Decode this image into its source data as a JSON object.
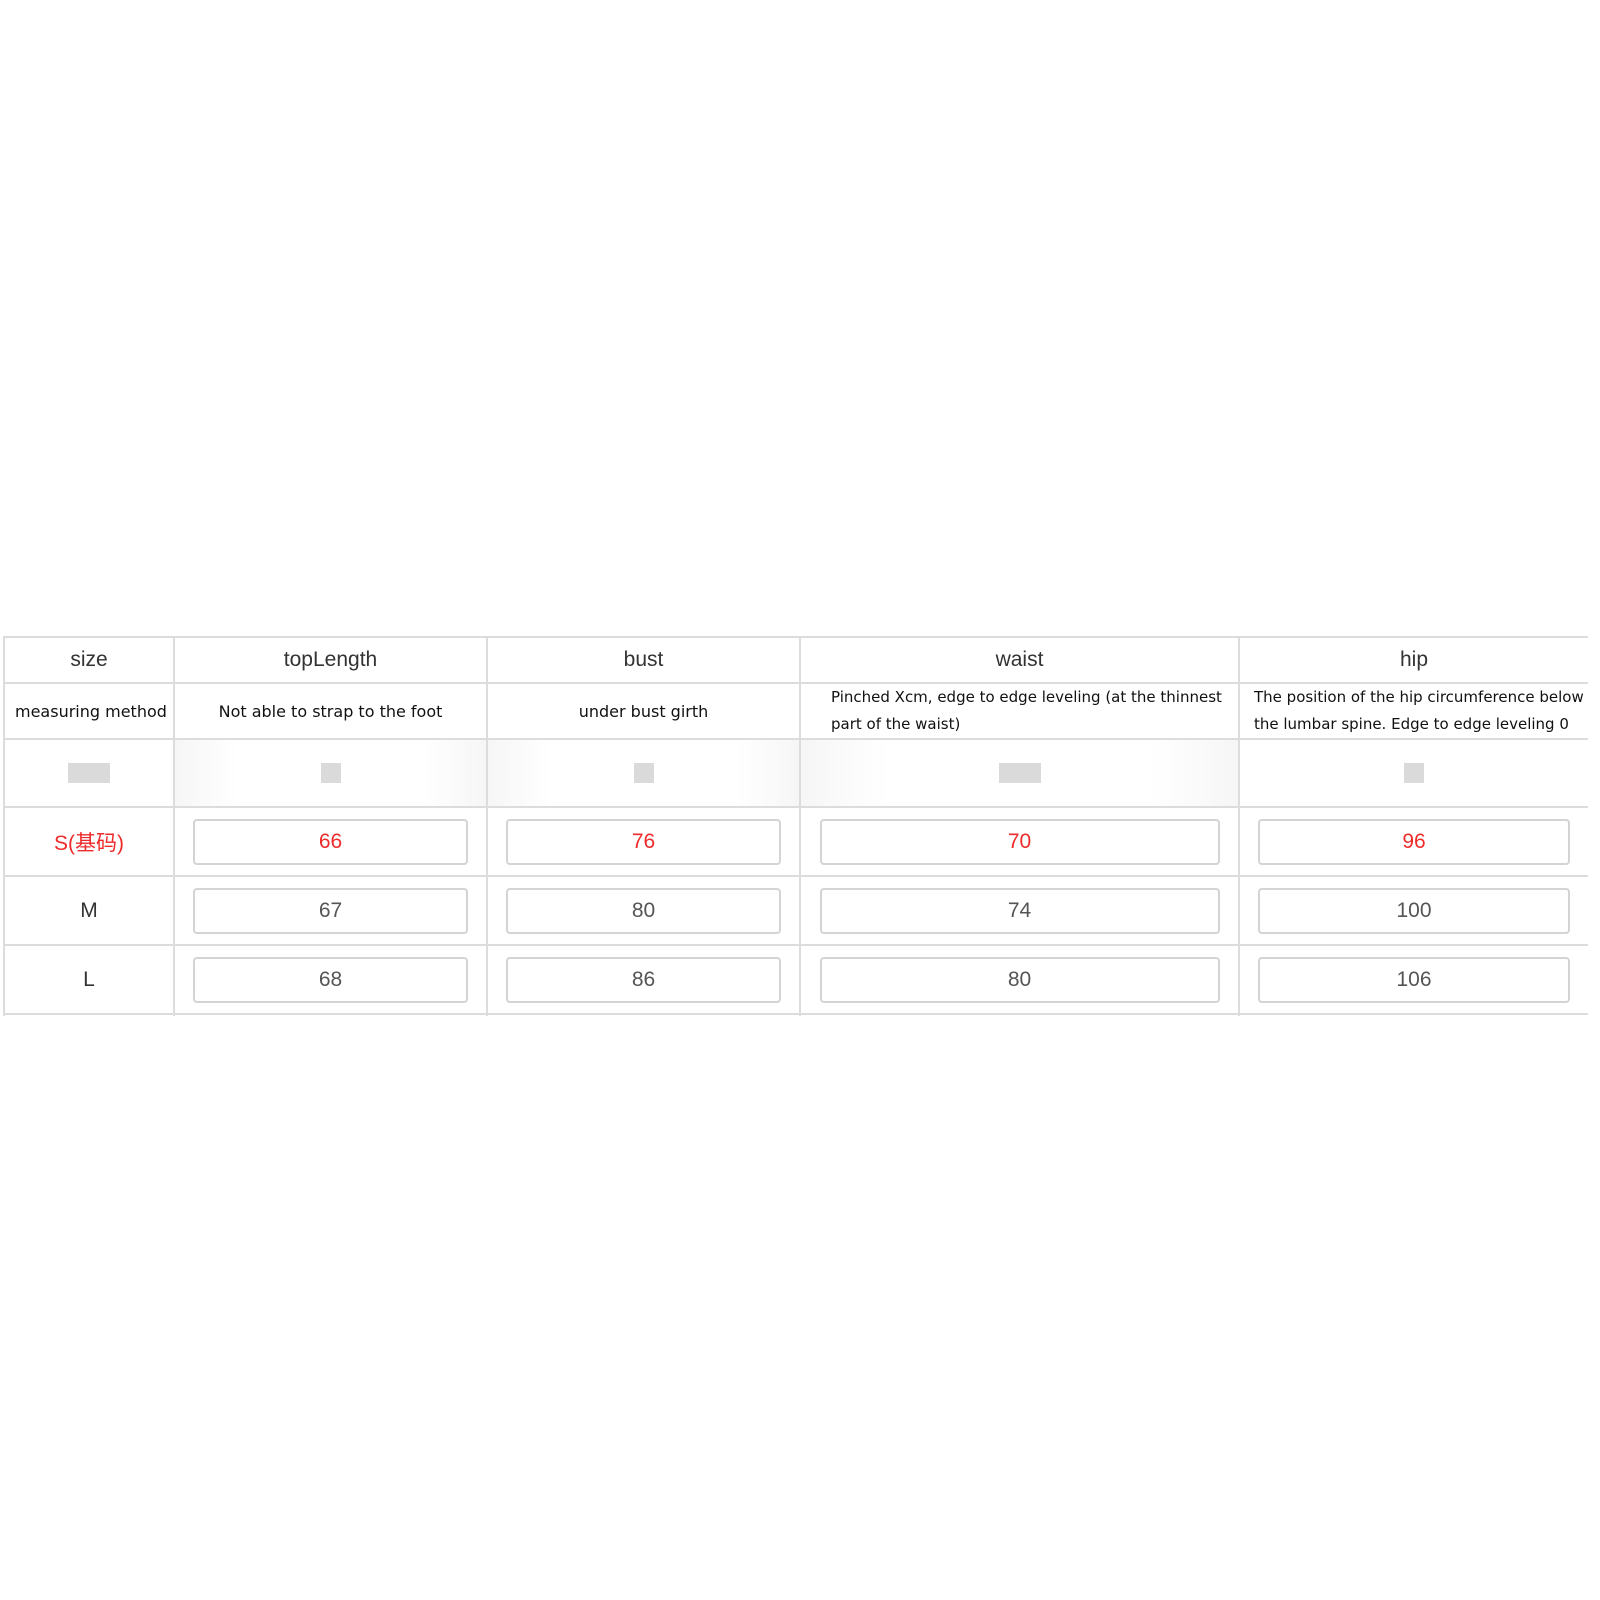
{
  "headers": [
    "size",
    "topLength",
    "bust",
    "waist",
    "hip"
  ],
  "method": {
    "label": "measuring method",
    "topLength": "Not able to strap to the foot",
    "bust": "under bust girth",
    "waist": "Pinched Xcm, edge to edge leveling (at the thinnest part of the waist)",
    "hip": "The position of the hip circumference below the lumbar spine. Edge to edge leveling 0"
  },
  "rows": [
    {
      "size": "S(基码)",
      "topLength": "66",
      "bust": "76",
      "waist": "70",
      "hip": "96"
    },
    {
      "size": "M",
      "topLength": "67",
      "bust": "80",
      "waist": "74",
      "hip": "100"
    },
    {
      "size": "L",
      "topLength": "68",
      "bust": "86",
      "waist": "80",
      "hip": "106"
    }
  ],
  "colors": {
    "base_size": "#ee2b2b",
    "border": "#dcdcdc",
    "text": "#333333"
  }
}
